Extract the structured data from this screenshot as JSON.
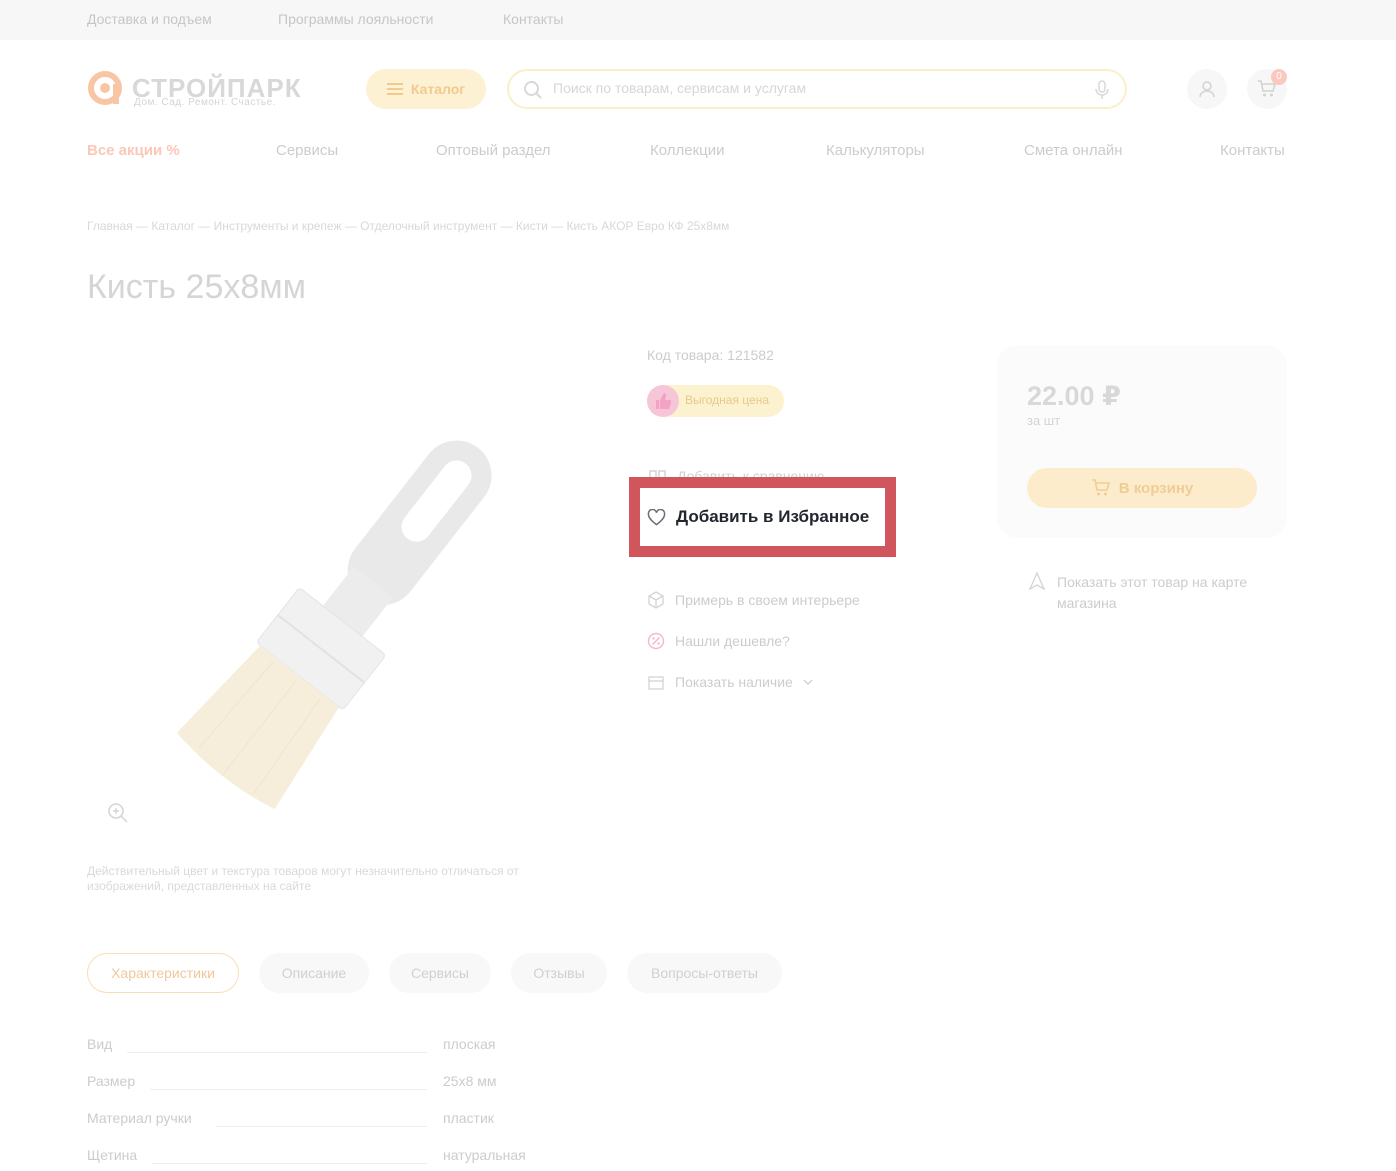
{
  "topbar": {
    "links": [
      "Доставка и подъем",
      "Программы лояльности",
      "Контакты"
    ]
  },
  "header": {
    "logo_text": "СТРОЙПАРК",
    "logo_tagline": "Дом. Сад. Ремонт. Счастье.",
    "catalog_label": "Каталог",
    "search_placeholder": "Поиск по товарам, сервисам и услугам",
    "cart_count": "0"
  },
  "nav": {
    "items": [
      "Все акции %",
      "Сервисы",
      "Оптовый раздел",
      "Коллекции",
      "Калькуляторы",
      "Смета онлайн",
      "Контакты"
    ]
  },
  "breadcrumb": "Главная — Каталог — Инструменты и крепеж — Отделочный инструмент — Кисти — Кисть АКОР Евро КФ 25х8мм",
  "product": {
    "title": "Кисть 25х8мм",
    "code": "Код товара: 121582",
    "badge": "Выгодная цена",
    "compare_label": "Добавить к сравнению",
    "favorite_label": "Добавить в Избранное",
    "try_interior": "Примерь в своем интерьере",
    "cheaper": "Нашли дешевле?",
    "availability": "Показать наличие",
    "disclaimer": "Действительный цвет и текстура товаров могут незначительно отличаться от изображений, представленных на сайте"
  },
  "price_card": {
    "price": "22.00 ₽",
    "unit": "за шт",
    "cart_button": "В корзину",
    "map_note": "Показать этот товар на карте магазина"
  },
  "tabs": [
    "Характеристики",
    "Описание",
    "Сервисы",
    "Отзывы",
    "Вопросы-ответы"
  ],
  "specs": [
    {
      "label": "Вид",
      "value": "плоская"
    },
    {
      "label": "Размер",
      "value": "25х8 мм"
    },
    {
      "label": "Материал ручки",
      "value": "пластик"
    },
    {
      "label": "Щетина",
      "value": "натуральная"
    }
  ],
  "colors": {
    "highlight_border": "#d0555c",
    "accent": "#f5c36a",
    "logo_orange": "#f7b48e"
  }
}
